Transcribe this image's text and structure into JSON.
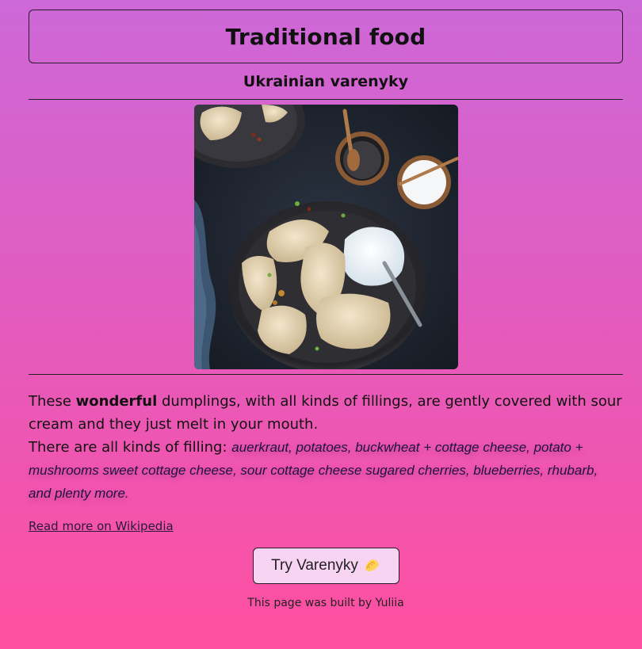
{
  "header": {
    "title": "Traditional food",
    "subtitle": "Ukrainian varenyky"
  },
  "description": {
    "part1_before": "These ",
    "part1_bold": "wonderful",
    "part1_after": " dumplings, with all kinds of fillings, are gently covered with sour cream and they just melt in your mouth.",
    "fillings_intro": "There are all kinds of filling: ",
    "fillings_list": "auerkraut, potatoes, buckwheat + cottage cheese, potato + mushrooms sweet cottage cheese, sour cottage cheese sugared cherries, blueberries, rhubarb, and plenty more."
  },
  "links": {
    "wikipedia": "Read more on Wikipedia"
  },
  "cta": {
    "label": "Try Varenyky",
    "icon": "dumpling-icon"
  },
  "footer": {
    "text": "This page was built by Yuliia"
  },
  "colors": {
    "background_top": "#cd68d8",
    "background_bottom": "#ff4fa0",
    "button_bg": "#f6d4f2"
  }
}
